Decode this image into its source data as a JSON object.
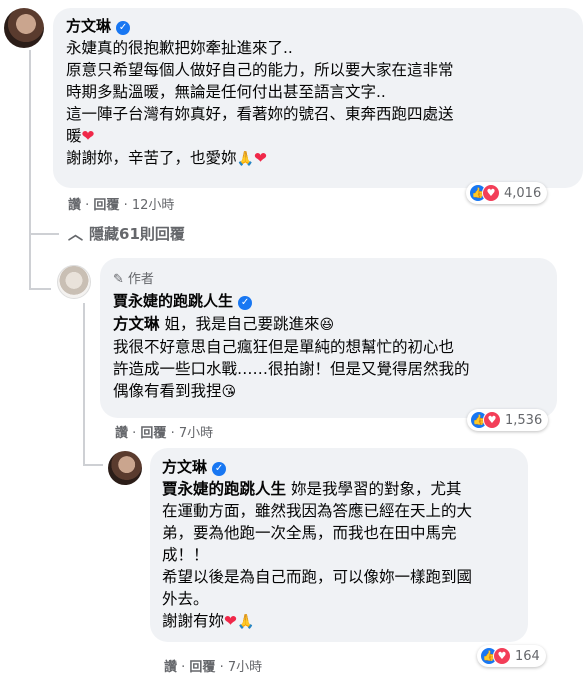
{
  "comment1": {
    "author": "方文琳",
    "lines": [
      "永婕真的很抱歉把妳牽扯進來了..",
      "原意只希望每個人做好自己的能力，所以要大家在這非常",
      "時期多點溫暖，無論是任何付出甚至語言文字..",
      "這一陣子台灣有妳真好，看著妳的號召、東奔西跑四處送",
      "暖"
    ],
    "last_line": "謝謝妳，辛苦了，也愛妳",
    "actions": {
      "like": "讚",
      "reply": "回覆",
      "time": "12小時"
    },
    "reaction_count": "4,016"
  },
  "hidden_replies": "隱藏61則回覆",
  "comment2": {
    "badge": "作者",
    "author": "賈永婕的跑跳人生",
    "mention": "方文琳",
    "first_line_rest": " 姐，我是自己要跳進來",
    "lines": [
      "我很不好意思自己瘋狂但是單純的想幫忙的初心也",
      "許造成一些口水戰……很拍謝！但是又覺得居然我的"
    ],
    "last_line": "偶像有看到我捏",
    "actions": {
      "like": "讚",
      "reply": "回覆",
      "time": "7小時"
    },
    "reaction_count": "1,536"
  },
  "comment3": {
    "author": "方文琳",
    "mention": "賈永婕的跑跳人生",
    "first_line_rest": " 妳是我學習的對象，尤其",
    "lines": [
      "在運動方面，雖然我因為答應已經在天上的大",
      "弟，要為他跑一次全馬，而我也在田中馬完",
      "成！！",
      "希望以後是為自己而跑，可以像妳一樣跑到國",
      "外去。"
    ],
    "last_line": "謝謝有妳",
    "actions": {
      "like": "讚",
      "reply": "回覆",
      "time": "7小時"
    },
    "reaction_count": "164"
  },
  "icons": [
    "verified-badge",
    "pencil-icon",
    "chevron-up-icon",
    "like-icon",
    "love-icon",
    "heart-emoji",
    "pray-emoji",
    "laugh-emoji",
    "kiss-emoji"
  ],
  "colors": {
    "bubble": "#f0f2f5",
    "like": "#1877f2",
    "love": "#f33e58",
    "meta": "#65676b"
  }
}
